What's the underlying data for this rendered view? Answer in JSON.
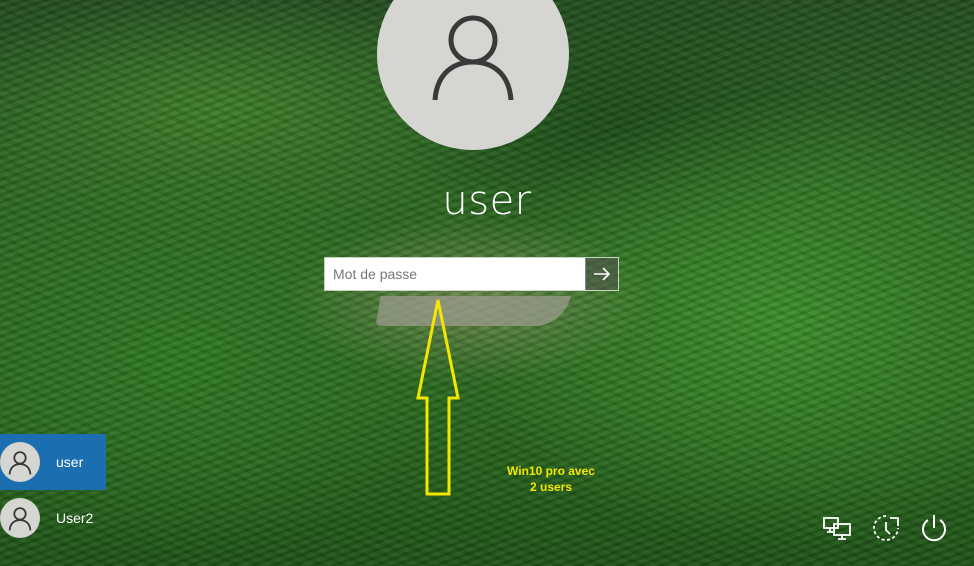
{
  "login": {
    "user_name": "user",
    "password_placeholder": "Mot de passe",
    "password_value": ""
  },
  "users": [
    {
      "name": "user",
      "selected": true
    },
    {
      "name": "User2",
      "selected": false
    }
  ],
  "annotation": {
    "line1": "Win10 pro avec",
    "line2": "2 users",
    "color": "#f3e600"
  },
  "system_icons": [
    "network-icon",
    "ease-of-access-icon",
    "power-icon"
  ],
  "colors": {
    "selected_user": "#1b6fb1",
    "avatar_bg": "#d5d6d2"
  }
}
